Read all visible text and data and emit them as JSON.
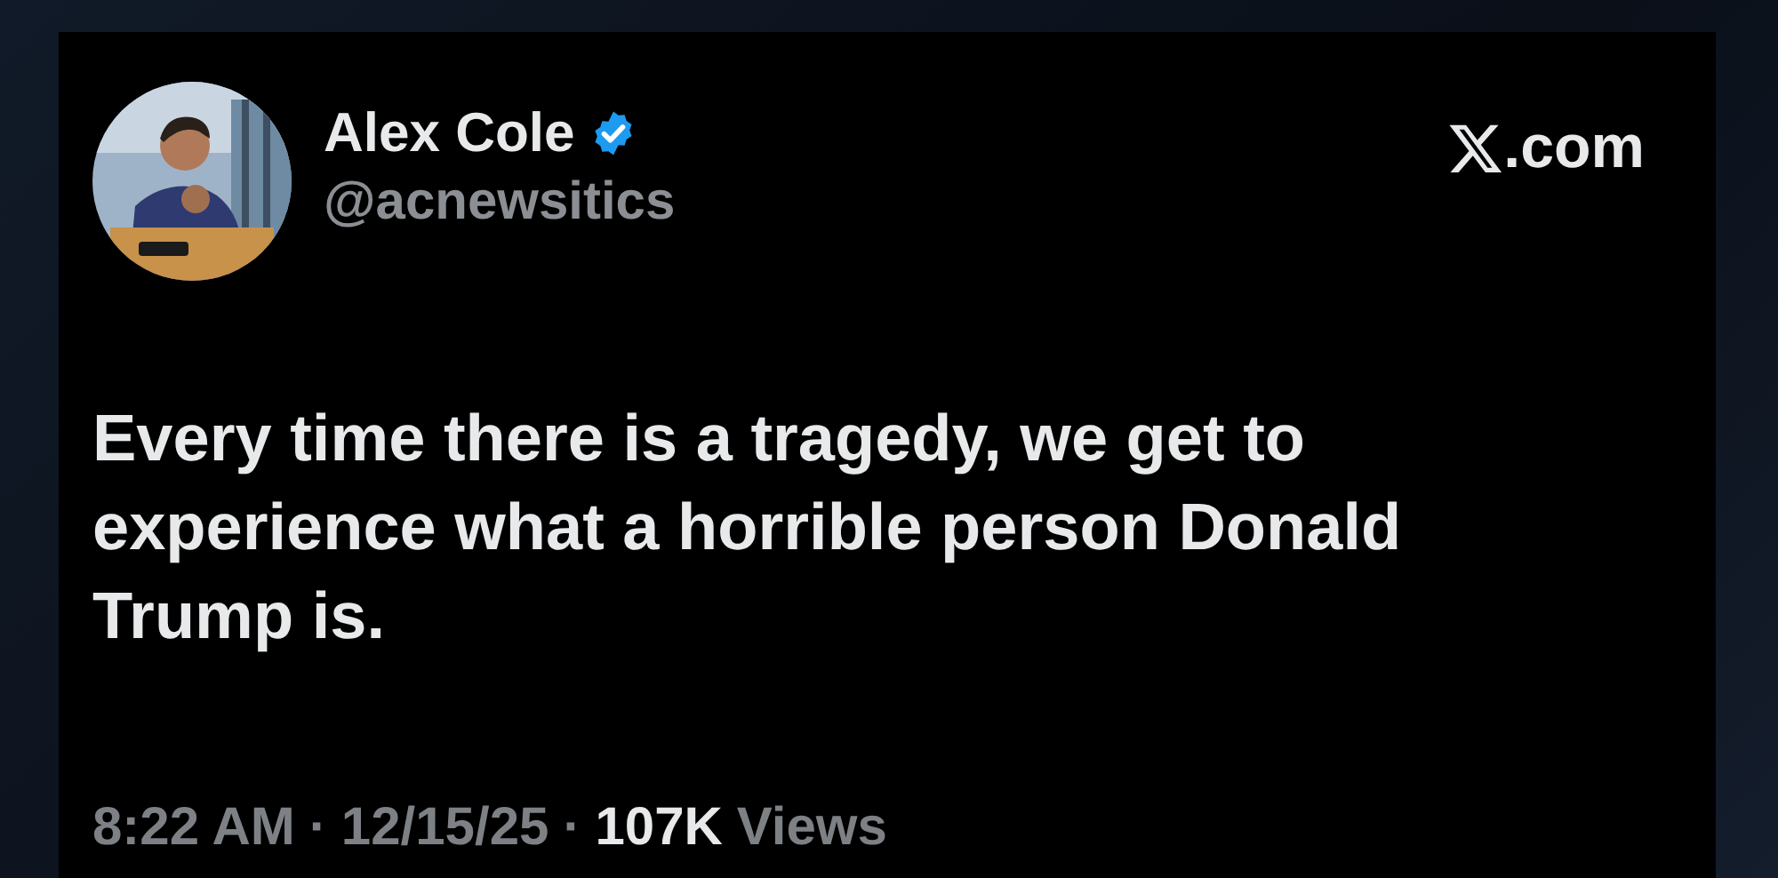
{
  "author": {
    "name": "Alex Cole",
    "verified": true,
    "handle": "@acnewsitics"
  },
  "source": {
    "domain": ".com"
  },
  "tweet": {
    "text": "Every time there is a tragedy, we get to experience what a horrible person Donald Trump is."
  },
  "footer": [
    {
      "text": "8:22 AM",
      "kind": "meta"
    },
    {
      "text": "·",
      "kind": "meta"
    },
    {
      "text": "12/15/25",
      "kind": "meta"
    },
    {
      "text": "·",
      "kind": "meta"
    },
    {
      "text": "107K",
      "kind": "count"
    },
    {
      "text": "Views",
      "kind": "meta"
    }
  ]
}
